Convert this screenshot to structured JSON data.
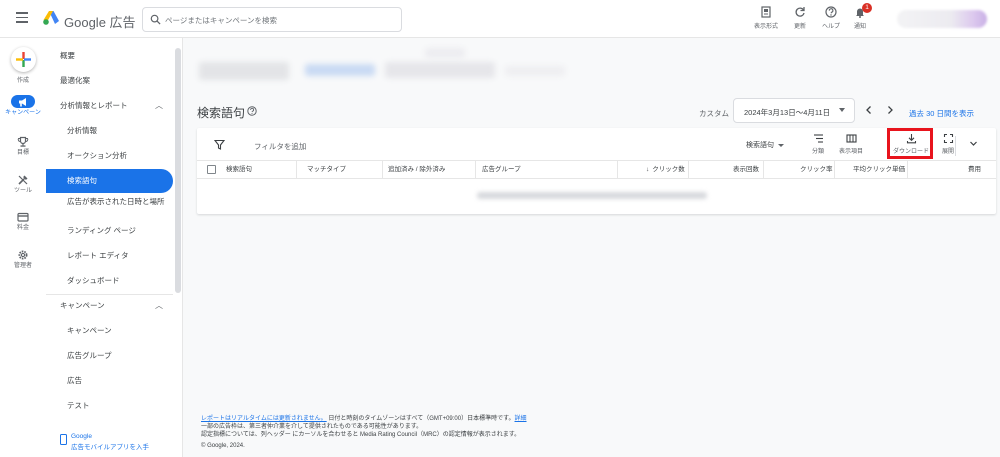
{
  "app": {
    "brand": "Google 広告"
  },
  "search": {
    "placeholder": "ページまたはキャンペーンを検索"
  },
  "top_actions": [
    {
      "label": "表示形式",
      "icon": "appearance-icon"
    },
    {
      "label": "更新",
      "icon": "refresh-icon"
    },
    {
      "label": "ヘルプ",
      "icon": "help-icon"
    },
    {
      "label": "通知",
      "icon": "bell-icon",
      "badge": "1"
    }
  ],
  "rail": {
    "create_label": "作成",
    "items": [
      {
        "label": "キャンペーン",
        "icon": "campaign-icon",
        "active": true
      },
      {
        "label": "目標",
        "icon": "trophy-icon"
      },
      {
        "label": "ツール",
        "icon": "tools-icon"
      },
      {
        "label": "料金",
        "icon": "billing-icon"
      },
      {
        "label": "管理者",
        "icon": "admin-icon"
      }
    ]
  },
  "nav": {
    "items": [
      {
        "label": "概要",
        "level": 0
      },
      {
        "label": "最適化案",
        "level": 0
      },
      {
        "label": "分析情報とレポート",
        "level": 0,
        "expandable": true
      },
      {
        "label": "分析情報",
        "level": 1
      },
      {
        "label": "オークション分析",
        "level": 1
      },
      {
        "label": "検索語句",
        "level": 1,
        "active": true
      },
      {
        "label": "広告が表示された日時と場所",
        "level": 1
      },
      {
        "label": "ランディング ページ",
        "level": 1
      },
      {
        "label": "レポート エディタ",
        "level": 1
      },
      {
        "label": "ダッシュボード",
        "level": 1
      },
      {
        "label": "キャンペーン",
        "level": 0,
        "expandable": true
      },
      {
        "label": "キャンペーン",
        "level": 1
      },
      {
        "label": "広告グループ",
        "level": 1
      },
      {
        "label": "広告",
        "level": 1
      },
      {
        "label": "テスト",
        "level": 1
      }
    ],
    "mobile_link_line1": "Google",
    "mobile_link_line2": "広告モバイルアプリを入手"
  },
  "main": {
    "title": "検索語句",
    "date_label": "カスタム",
    "date_range": "2024年3月13日～4月11日",
    "compare_link": "過去 30 日間を表示",
    "filter_placeholder": "フィルタを追加",
    "segment_select": "検索語句",
    "tools": [
      {
        "label": "分類",
        "icon": "segment-icon"
      },
      {
        "label": "表示項目",
        "icon": "columns-icon"
      },
      {
        "label": "ダウンロード",
        "icon": "download-icon",
        "highlighted": true
      },
      {
        "label": "展開",
        "icon": "fullscreen-icon"
      }
    ],
    "columns": [
      "検索語句",
      "マッチタイプ",
      "追加済み / 除外済み",
      "広告グループ",
      "クリック数",
      "表示回数",
      "クリック率",
      "平均クリック単価",
      "費用"
    ]
  },
  "footer": {
    "line1_link": "レポートはリアルタイムには更新されません。",
    "line1_text": " 日付と時刻のタイムゾーンはすべて（GMT+09:00）日本標準時です。",
    "line1_link2": "詳細",
    "line2": "一部の広告枠は、第三者仲介業を介して提供されたものである可能性があります。",
    "line3": "認定指標については、列ヘッダー にカーソルを合わせると Media Rating Council（MRC）の認定情報が表示されます。",
    "copyright": "© Google, 2024."
  },
  "colors": {
    "accent": "#1a73e8",
    "highlight_box": "#e8141d",
    "badge": "#d93025"
  }
}
